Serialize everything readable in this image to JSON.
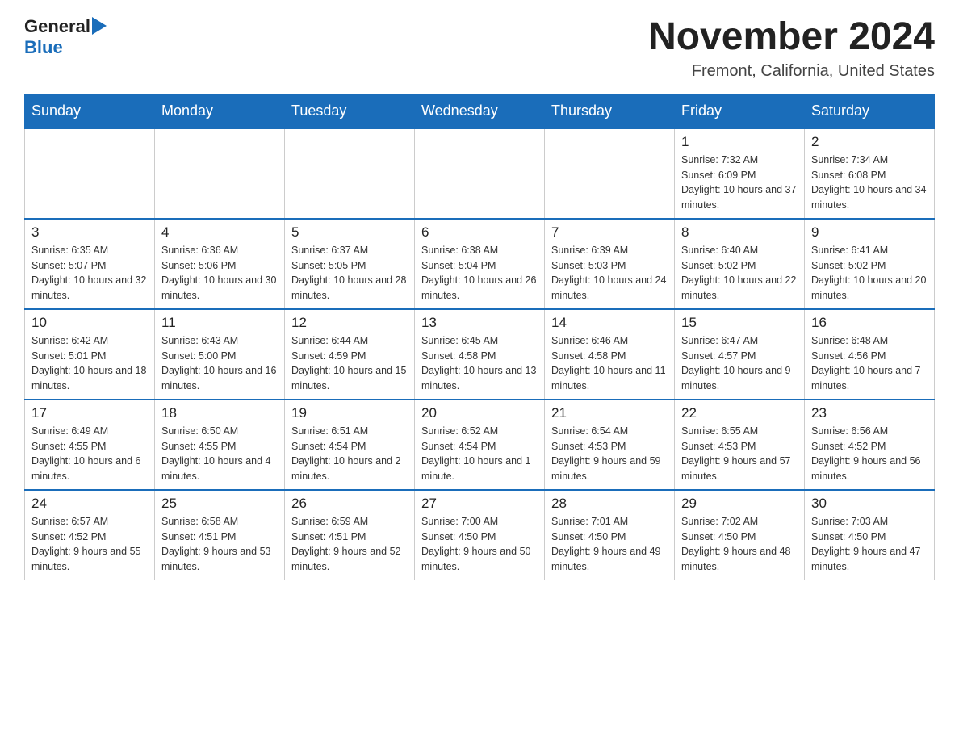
{
  "logo": {
    "text_general": "General",
    "text_blue": "Blue",
    "arrow_label": "logo-arrow"
  },
  "title": "November 2024",
  "subtitle": "Fremont, California, United States",
  "weekdays": [
    "Sunday",
    "Monday",
    "Tuesday",
    "Wednesday",
    "Thursday",
    "Friday",
    "Saturday"
  ],
  "weeks": [
    [
      {
        "day": "",
        "info": ""
      },
      {
        "day": "",
        "info": ""
      },
      {
        "day": "",
        "info": ""
      },
      {
        "day": "",
        "info": ""
      },
      {
        "day": "",
        "info": ""
      },
      {
        "day": "1",
        "info": "Sunrise: 7:32 AM\nSunset: 6:09 PM\nDaylight: 10 hours and 37 minutes."
      },
      {
        "day": "2",
        "info": "Sunrise: 7:34 AM\nSunset: 6:08 PM\nDaylight: 10 hours and 34 minutes."
      }
    ],
    [
      {
        "day": "3",
        "info": "Sunrise: 6:35 AM\nSunset: 5:07 PM\nDaylight: 10 hours and 32 minutes."
      },
      {
        "day": "4",
        "info": "Sunrise: 6:36 AM\nSunset: 5:06 PM\nDaylight: 10 hours and 30 minutes."
      },
      {
        "day": "5",
        "info": "Sunrise: 6:37 AM\nSunset: 5:05 PM\nDaylight: 10 hours and 28 minutes."
      },
      {
        "day": "6",
        "info": "Sunrise: 6:38 AM\nSunset: 5:04 PM\nDaylight: 10 hours and 26 minutes."
      },
      {
        "day": "7",
        "info": "Sunrise: 6:39 AM\nSunset: 5:03 PM\nDaylight: 10 hours and 24 minutes."
      },
      {
        "day": "8",
        "info": "Sunrise: 6:40 AM\nSunset: 5:02 PM\nDaylight: 10 hours and 22 minutes."
      },
      {
        "day": "9",
        "info": "Sunrise: 6:41 AM\nSunset: 5:02 PM\nDaylight: 10 hours and 20 minutes."
      }
    ],
    [
      {
        "day": "10",
        "info": "Sunrise: 6:42 AM\nSunset: 5:01 PM\nDaylight: 10 hours and 18 minutes."
      },
      {
        "day": "11",
        "info": "Sunrise: 6:43 AM\nSunset: 5:00 PM\nDaylight: 10 hours and 16 minutes."
      },
      {
        "day": "12",
        "info": "Sunrise: 6:44 AM\nSunset: 4:59 PM\nDaylight: 10 hours and 15 minutes."
      },
      {
        "day": "13",
        "info": "Sunrise: 6:45 AM\nSunset: 4:58 PM\nDaylight: 10 hours and 13 minutes."
      },
      {
        "day": "14",
        "info": "Sunrise: 6:46 AM\nSunset: 4:58 PM\nDaylight: 10 hours and 11 minutes."
      },
      {
        "day": "15",
        "info": "Sunrise: 6:47 AM\nSunset: 4:57 PM\nDaylight: 10 hours and 9 minutes."
      },
      {
        "day": "16",
        "info": "Sunrise: 6:48 AM\nSunset: 4:56 PM\nDaylight: 10 hours and 7 minutes."
      }
    ],
    [
      {
        "day": "17",
        "info": "Sunrise: 6:49 AM\nSunset: 4:55 PM\nDaylight: 10 hours and 6 minutes."
      },
      {
        "day": "18",
        "info": "Sunrise: 6:50 AM\nSunset: 4:55 PM\nDaylight: 10 hours and 4 minutes."
      },
      {
        "day": "19",
        "info": "Sunrise: 6:51 AM\nSunset: 4:54 PM\nDaylight: 10 hours and 2 minutes."
      },
      {
        "day": "20",
        "info": "Sunrise: 6:52 AM\nSunset: 4:54 PM\nDaylight: 10 hours and 1 minute."
      },
      {
        "day": "21",
        "info": "Sunrise: 6:54 AM\nSunset: 4:53 PM\nDaylight: 9 hours and 59 minutes."
      },
      {
        "day": "22",
        "info": "Sunrise: 6:55 AM\nSunset: 4:53 PM\nDaylight: 9 hours and 57 minutes."
      },
      {
        "day": "23",
        "info": "Sunrise: 6:56 AM\nSunset: 4:52 PM\nDaylight: 9 hours and 56 minutes."
      }
    ],
    [
      {
        "day": "24",
        "info": "Sunrise: 6:57 AM\nSunset: 4:52 PM\nDaylight: 9 hours and 55 minutes."
      },
      {
        "day": "25",
        "info": "Sunrise: 6:58 AM\nSunset: 4:51 PM\nDaylight: 9 hours and 53 minutes."
      },
      {
        "day": "26",
        "info": "Sunrise: 6:59 AM\nSunset: 4:51 PM\nDaylight: 9 hours and 52 minutes."
      },
      {
        "day": "27",
        "info": "Sunrise: 7:00 AM\nSunset: 4:50 PM\nDaylight: 9 hours and 50 minutes."
      },
      {
        "day": "28",
        "info": "Sunrise: 7:01 AM\nSunset: 4:50 PM\nDaylight: 9 hours and 49 minutes."
      },
      {
        "day": "29",
        "info": "Sunrise: 7:02 AM\nSunset: 4:50 PM\nDaylight: 9 hours and 48 minutes."
      },
      {
        "day": "30",
        "info": "Sunrise: 7:03 AM\nSunset: 4:50 PM\nDaylight: 9 hours and 47 minutes."
      }
    ]
  ]
}
